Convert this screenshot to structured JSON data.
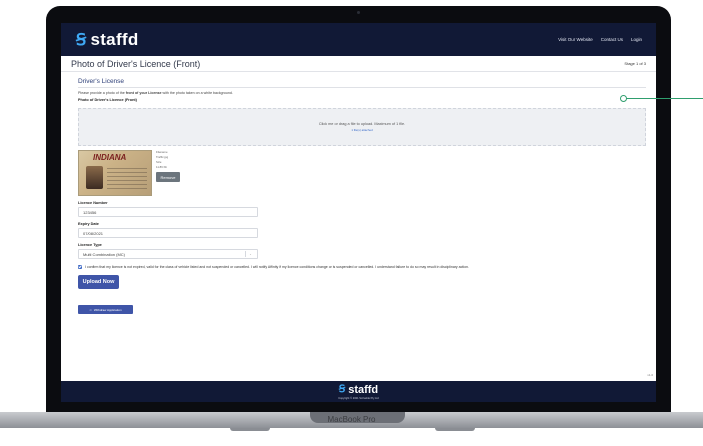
{
  "header": {
    "logo_text": "staffd",
    "nav_links": [
      "Visit Our Website",
      "Contact Us",
      "Login"
    ]
  },
  "page": {
    "title": "Photo of Driver's Licence (Front)",
    "stage": "Stage 1 of 3"
  },
  "section": {
    "title": "Driver's License",
    "instruction_prefix": "Please provide a photo of the ",
    "instruction_bold": "front of your License",
    "instruction_suffix": " with the photo taken on a white background.",
    "field_label": "Photo of Driver's Licence (Front)"
  },
  "dropzone": {
    "text": "Click me or drag a file to upload. Maximum of 1 file.",
    "subtext": "1 file(s) attached"
  },
  "file": {
    "card_title": "INDIANA",
    "filename_label": "Filename",
    "filename": "Traffic.jpg",
    "size_label": "Size",
    "size": "11.86 Kb",
    "remove_label": "Remove"
  },
  "form": {
    "licence_number_label": "Licence Number",
    "licence_number_value": "123456",
    "expiry_label": "Expiry Date",
    "expiry_value": "07/08/2021",
    "type_label": "Licence Type",
    "type_value": "Multi Combination (MC)",
    "type_caret": "⌄",
    "confirm_text": "I confirm that my licence is not expired, valid for the class of vehicle listed and not suspended or cancelled. I will notify Affinity if my licence conditions change or is suspended or cancelled. I understand failure to do so may result in disciplinary action.",
    "upload_label": "Upload Now",
    "withdraw_icon": "⇦",
    "withdraw_label": "Withdraw Application"
  },
  "version": "v1.0",
  "footer": {
    "logo_text": "staffd",
    "copyright": "Copyright © 2021 Scriveble Pty Ltd"
  },
  "device": {
    "label": "MacBook Pro"
  },
  "colors": {
    "nav_bg": "#111936",
    "brand_blue": "#3fa9f5",
    "button_blue": "#3f55a8",
    "callout_green": "#2f9e6e"
  }
}
